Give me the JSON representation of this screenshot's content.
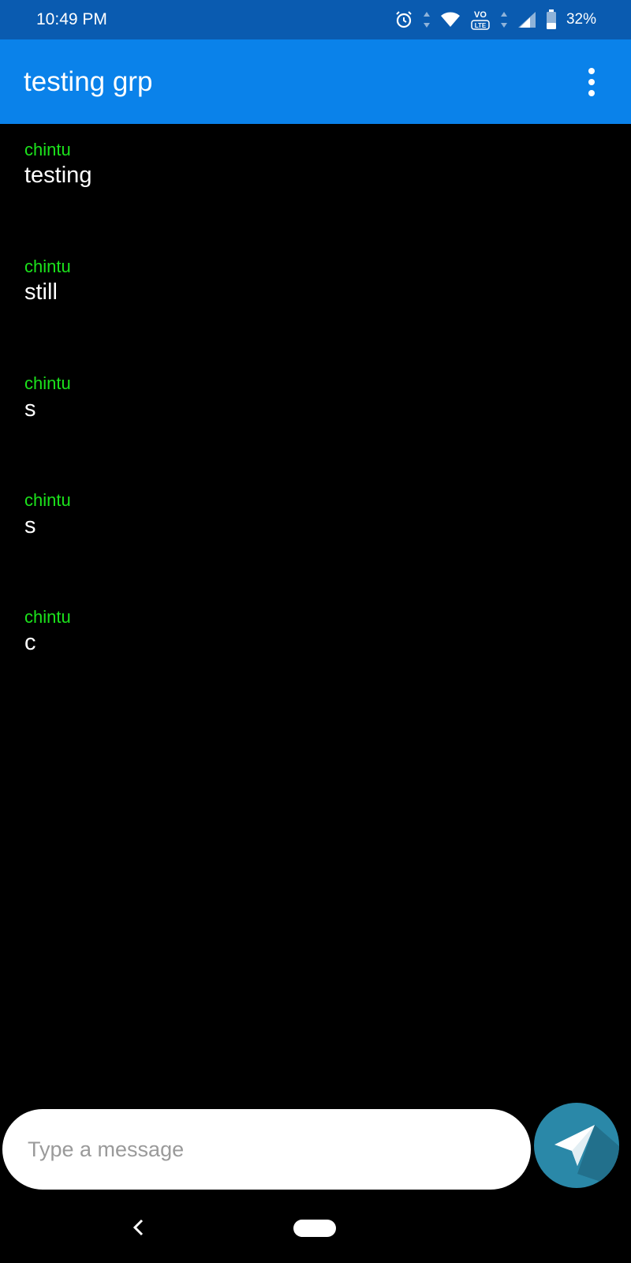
{
  "status_bar": {
    "time": "10:49 PM",
    "battery_percent": "32%",
    "icons": [
      "alarm-icon",
      "data-arrows-icon",
      "wifi-icon",
      "volte-icon",
      "signal-icon",
      "battery-icon"
    ],
    "volte_label_top": "VO",
    "volte_label_bottom": "LTE"
  },
  "app_bar": {
    "title": "testing grp",
    "menu_icon": "more-vert-icon"
  },
  "messages": [
    {
      "sender": "chintu",
      "text": "testing"
    },
    {
      "sender": "chintu",
      "text": "still"
    },
    {
      "sender": "chintu",
      "text": "s"
    },
    {
      "sender": "chintu",
      "text": "s"
    },
    {
      "sender": "chintu",
      "text": "c"
    }
  ],
  "composer": {
    "placeholder": "Type a message",
    "value": "",
    "send_icon": "send-icon"
  },
  "nav_bar": {
    "back_icon": "back-icon",
    "home_icon": "home-pill-icon"
  },
  "colors": {
    "status_bar_bg": "#0a5bb0",
    "app_bar_bg": "#0a82ea",
    "sender_name": "#1ce31c",
    "send_button_bg": "#2a88a8"
  }
}
